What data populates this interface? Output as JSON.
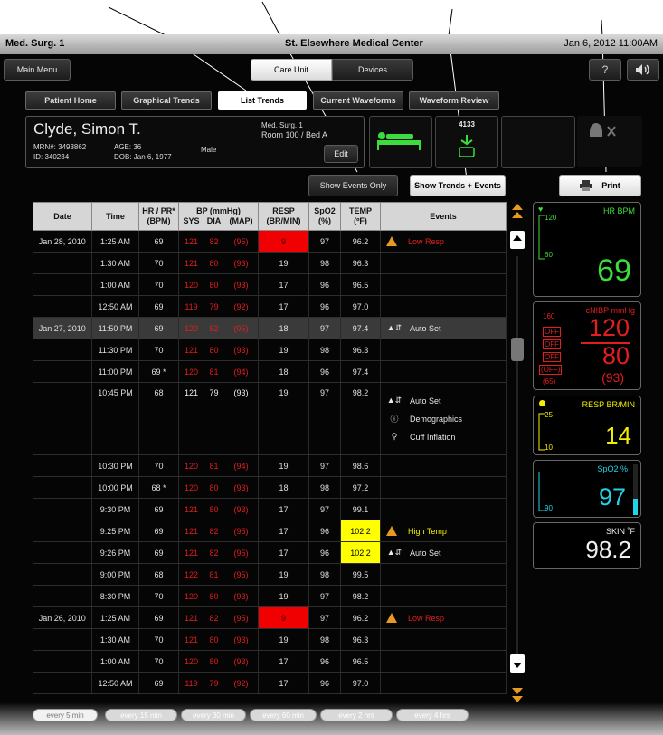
{
  "header": {
    "unit": "Med. Surg. 1",
    "hospital": "St. Elsewhere Medical Center",
    "datetime": "Jan 6, 2012  11:00AM"
  },
  "nav": {
    "main_menu": "Main Menu",
    "segments": [
      "Care Unit",
      "Devices"
    ],
    "tabs": [
      "Patient Home",
      "Graphical Trends",
      "List Trends",
      "Current Waveforms",
      "Waveform Review"
    ]
  },
  "patient": {
    "name": "Clyde, Simon T.",
    "mrn": "MRN#: 3493862",
    "id": "ID: 340234",
    "age": "AGE: 36",
    "dob": "DOB: Jan 6, 1977",
    "sex": "Male",
    "unit": "Med. Surg. 1",
    "room": "Room 100 / Bed A",
    "edit": "Edit",
    "device_num": "4133"
  },
  "actions": {
    "events_only": "Show Events Only",
    "trends_events": "Show Trends + Events",
    "print": "Print"
  },
  "table": {
    "headers": {
      "date": "Date",
      "time": "Time",
      "hr1": "HR / PR*",
      "hr2": "(BPM)",
      "bp1": "BP (mmHg)",
      "sys": "SYS",
      "dia": "DIA",
      "map": "(MAP)",
      "resp1": "RESP",
      "resp2": "(BR/MIN)",
      "spo1": "SpO2",
      "spo2": "(%)",
      "temp1": "TEMP",
      "temp2": "(ºF)",
      "events": "Events"
    },
    "rows": [
      {
        "date": "Jan 28, 2010",
        "time": "1:25 AM",
        "hr": "69",
        "sys": "121",
        "dia": "82",
        "map": "(95)",
        "resp": "9",
        "resp_alarm": true,
        "spo2": "97",
        "temp": "96.2",
        "events": [
          {
            "icon": "warn",
            "text": "Low Resp",
            "red": true
          }
        ]
      },
      {
        "date": "",
        "time": "1:30 AM",
        "hr": "70",
        "sys": "121",
        "dia": "80",
        "map": "(93)",
        "resp": "19",
        "spo2": "98",
        "temp": "96.3",
        "events": []
      },
      {
        "date": "",
        "time": "1:00 AM",
        "hr": "70",
        "sys": "120",
        "dia": "80",
        "map": "(93)",
        "resp": "17",
        "spo2": "96",
        "temp": "96.5",
        "events": []
      },
      {
        "date": "",
        "time": "12:50 AM",
        "hr": "69",
        "sys": "119",
        "dia": "79",
        "map": "(92)",
        "resp": "17",
        "spo2": "96",
        "temp": "97.0",
        "events": []
      },
      {
        "date": "Jan 27, 2010",
        "time": "11:50 PM",
        "hr": "69",
        "sys": "120",
        "dia": "82",
        "map": "(95)",
        "resp": "18",
        "spo2": "97",
        "temp": "97.4",
        "selected": true,
        "events": [
          {
            "icon": "auto",
            "text": "Auto Set"
          }
        ]
      },
      {
        "date": "",
        "time": "11:30 PM",
        "hr": "70",
        "sys": "121",
        "dia": "80",
        "map": "(93)",
        "resp": "19",
        "spo2": "98",
        "temp": "96.3",
        "events": []
      },
      {
        "date": "",
        "time": "11:00 PM",
        "hr": "69 *",
        "sys": "120",
        "dia": "81",
        "map": "(94)",
        "resp": "18",
        "spo2": "96",
        "temp": "97.4",
        "events": []
      },
      {
        "date": "",
        "time": "10:45 PM",
        "hr": "68",
        "sys": "121",
        "dia": "79",
        "map": "(93)",
        "resp": "19",
        "spo2": "97",
        "temp": "98.2",
        "white_bp": true,
        "events": [
          {
            "icon": "auto",
            "text": "Auto Set"
          },
          {
            "icon": "info",
            "text": "Demographics"
          },
          {
            "icon": "cuff",
            "text": "Cuff Inflation"
          }
        ]
      },
      {
        "date": "",
        "time": "10:30 PM",
        "hr": "70",
        "sys": "120",
        "dia": "81",
        "map": "(94)",
        "resp": "19",
        "spo2": "97",
        "temp": "98.6",
        "events": []
      },
      {
        "date": "",
        "time": "10:00 PM",
        "hr": "68 *",
        "sys": "120",
        "dia": "80",
        "map": "(93)",
        "resp": "18",
        "spo2": "98",
        "temp": "97.2",
        "events": []
      },
      {
        "date": "",
        "time": "9:30 PM",
        "hr": "69",
        "sys": "121",
        "dia": "80",
        "map": "(93)",
        "resp": "17",
        "spo2": "97",
        "temp": "99.1",
        "events": []
      },
      {
        "date": "",
        "time": "9:25 PM",
        "hr": "69",
        "sys": "121",
        "dia": "82",
        "map": "(95)",
        "resp": "17",
        "spo2": "96",
        "temp": "102.2",
        "temp_alarm": true,
        "events": [
          {
            "icon": "warn",
            "text": "High Temp",
            "yellow": true
          }
        ]
      },
      {
        "date": "",
        "time": "9:26 PM",
        "hr": "69",
        "sys": "121",
        "dia": "82",
        "map": "(95)",
        "resp": "17",
        "spo2": "96",
        "temp": "102.2",
        "temp_alarm": true,
        "events": [
          {
            "icon": "auto",
            "text": "Auto Set"
          }
        ]
      },
      {
        "date": "",
        "time": "9:00 PM",
        "hr": "68",
        "sys": "122",
        "dia": "81",
        "map": "(95)",
        "resp": "19",
        "spo2": "98",
        "temp": "99.5",
        "events": []
      },
      {
        "date": "",
        "time": "8:30 PM",
        "hr": "70",
        "sys": "120",
        "dia": "80",
        "map": "(93)",
        "resp": "19",
        "spo2": "97",
        "temp": "98.2",
        "events": []
      },
      {
        "date": "Jan 26, 2010",
        "time": "1:25 AM",
        "hr": "69",
        "sys": "121",
        "dia": "82",
        "map": "(95)",
        "resp": "9",
        "resp_alarm": true,
        "spo2": "97",
        "temp": "96.2",
        "events": [
          {
            "icon": "warn",
            "text": "Low Resp",
            "red": true
          }
        ]
      },
      {
        "date": "",
        "time": "1:30 AM",
        "hr": "70",
        "sys": "121",
        "dia": "80",
        "map": "(93)",
        "resp": "19",
        "spo2": "98",
        "temp": "96.3",
        "events": []
      },
      {
        "date": "",
        "time": "1:00 AM",
        "hr": "70",
        "sys": "120",
        "dia": "80",
        "map": "(93)",
        "resp": "17",
        "spo2": "96",
        "temp": "96.5",
        "events": []
      },
      {
        "date": "",
        "time": "12:50 AM",
        "hr": "69",
        "sys": "119",
        "dia": "79",
        "map": "(92)",
        "resp": "17",
        "spo2": "96",
        "temp": "97.0",
        "events": []
      }
    ]
  },
  "vitals": {
    "hr": {
      "label": "HR BPM",
      "hi": "120",
      "lo": "60",
      "value": "69"
    },
    "nibp": {
      "label": "cNIBP mmHg",
      "sys": "120",
      "dia": "80",
      "map": "(93)",
      "lim1": "160",
      "lim2": "OFF",
      "lim3": "OFF",
      "lim4": "OFF",
      "lim5": "(OFF)",
      "lim6": "(65)"
    },
    "resp": {
      "label": "RESP BR/MIN",
      "hi": "25",
      "lo": "10",
      "value": "14"
    },
    "spo2": {
      "label": "SpO2 %",
      "lo": "90",
      "value": "97"
    },
    "skin": {
      "label": "SKIN ˚F",
      "value": "98.2"
    }
  },
  "intervals": [
    "every 5 min",
    "every 15 min",
    "every 30 min",
    "every 60 min",
    "every 2 hrs",
    "every 4 hrs"
  ],
  "colors": {
    "hr": "#3cdc3c",
    "bp": "#e21e1e",
    "resp": "#f0f000",
    "spo2": "#20d4e8",
    "alarm_red": "#f00000",
    "alarm_yellow": "#ffff00"
  }
}
